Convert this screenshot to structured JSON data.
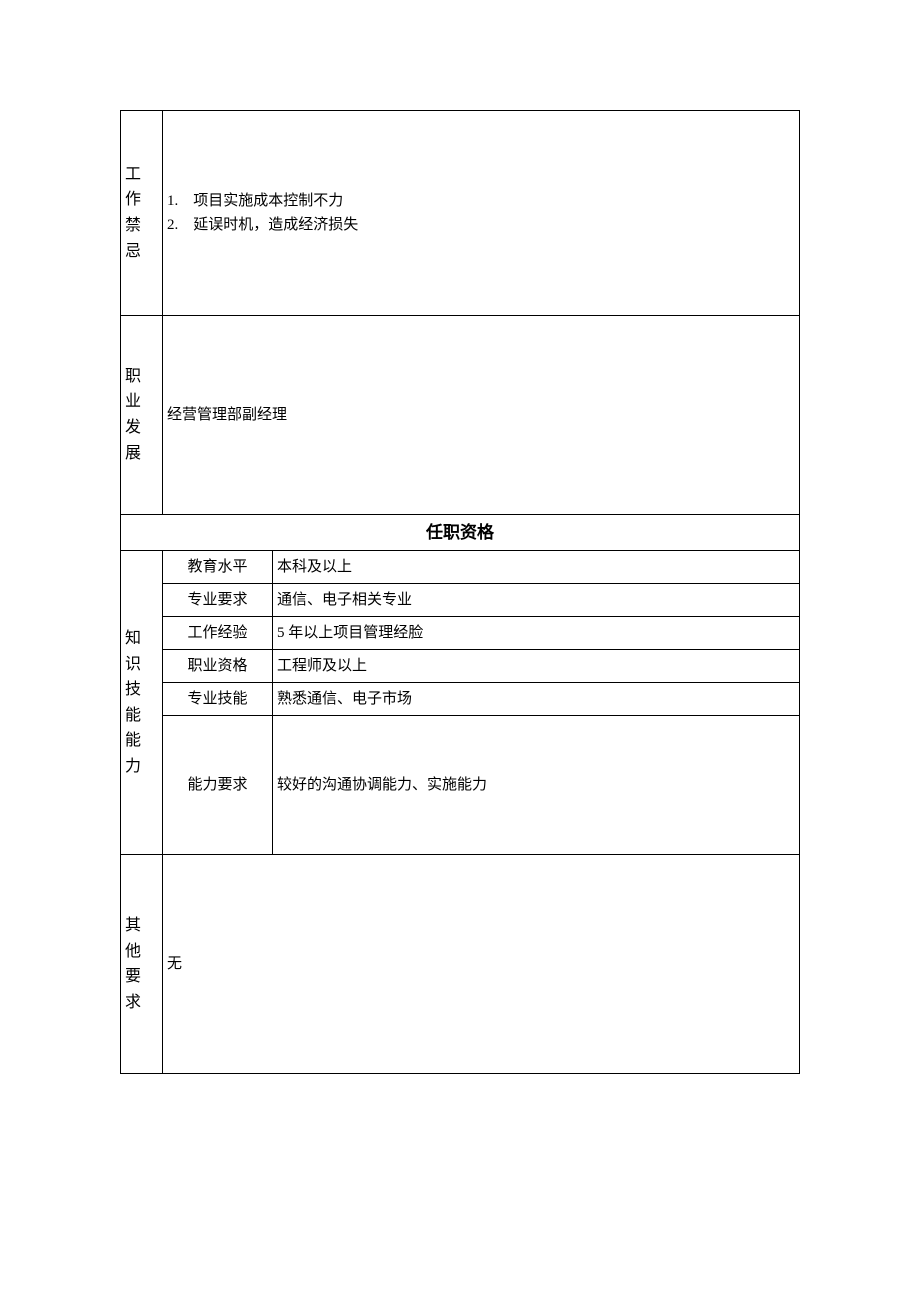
{
  "rows": {
    "taboo": {
      "label": "工 作 禁 忌",
      "items": [
        "1.　项目实施成本控制不力",
        "2.　延误时机，造成经济损失"
      ]
    },
    "career": {
      "label": "职业发展",
      "value": "经营管理部副经理"
    },
    "qualification_header": "任职资格",
    "knowledge_label": "知识技能能力",
    "qual": {
      "edu": {
        "label": "教育水平",
        "value": "本科及以上"
      },
      "major": {
        "label": "专业要求",
        "value": "通信、电子相关专业"
      },
      "exp": {
        "label": "工作经验",
        "value": "5 年以上项目管理经脸"
      },
      "cert": {
        "label": "职业资格",
        "value": "工程师及以上"
      },
      "skill": {
        "label": "专业技能",
        "value": "熟悉通信、电子市场"
      },
      "ability": {
        "label": "能力要求",
        "value": "较好的沟通协调能力、实施能力"
      }
    },
    "other": {
      "label": "其 他 要 求",
      "value": "无"
    }
  }
}
